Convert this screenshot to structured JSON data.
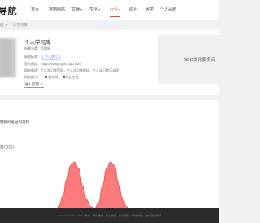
{
  "header": {
    "logo": "导航",
    "nav": [
      {
        "label": "首页",
        "dropdown": false
      },
      {
        "label": "常用网站",
        "dropdown": false
      },
      {
        "label": "文娱",
        "dropdown": true
      },
      {
        "label": "生活",
        "dropdown": true
      },
      {
        "label": "行业",
        "dropdown": true,
        "active": true
      },
      {
        "label": "综合",
        "dropdown": false
      },
      {
        "label": "大学",
        "dropdown": false
      },
      {
        "label": "个人品牌",
        "dropdown": false
      }
    ]
  },
  "breadcrumb": "牌 > 个人学习库",
  "site": {
    "name": "个人学习库",
    "lines": {
      "category_label": "所属分类：",
      "category_value": "互联网",
      "tags_label": "网站标签：",
      "tag": "个人学习",
      "url_label": "官方网址：",
      "url_value": "https://blog.gxlu.top.com",
      "intro_label": "网站描述：",
      "intro_value": "个人学习库官网，个人学习库网址，个人学习库怎么样",
      "stats_label": "网站统计：",
      "stat1": "爱站网",
      "stat2": "站长工具"
    },
    "enter_label": "进入官网 ⓘ"
  },
  "ad": {
    "text": "SEO优化服务商"
  },
  "section": {
    "title": "网站的笔记和资料",
    "chart_label": "量(万次)"
  },
  "chart_data": {
    "type": "area",
    "series": [
      {
        "values": [
          0,
          0,
          0,
          0,
          0,
          2,
          8,
          18,
          26,
          28,
          24,
          14,
          6,
          2,
          1,
          4,
          14,
          24,
          28,
          26,
          16,
          7,
          2,
          0,
          0,
          0
        ]
      }
    ],
    "colors": {
      "fill": "#ff6b6b",
      "stroke": "#e84a4a"
    }
  },
  "footer": {
    "text": "Copyright © 2023 · 导航 · 网站收录 · 联系我们 · 关于我们 · 网站地图 · 友情链接申请"
  }
}
